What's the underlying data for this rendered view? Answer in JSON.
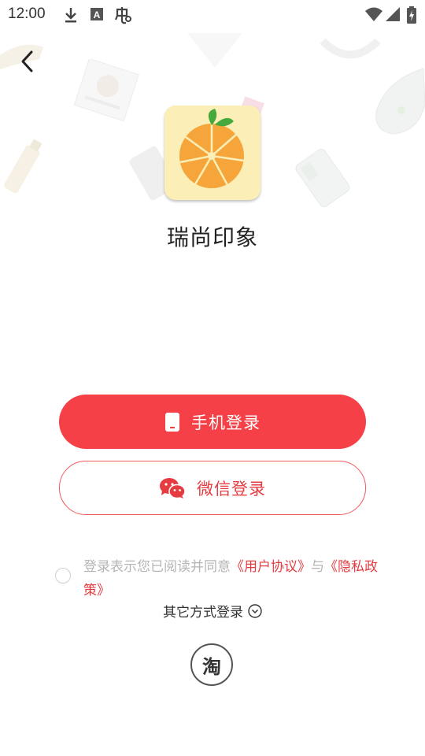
{
  "status_bar": {
    "time": "12:00",
    "icons": [
      "download-icon",
      "font-a-icon",
      "notification-app-icon",
      "wifi-icon",
      "signal-icon",
      "battery-charging-icon"
    ]
  },
  "header": {
    "back_icon": "chevron-left-icon"
  },
  "app": {
    "name": "瑞尚印象",
    "logo_icon": "orange-slice-logo"
  },
  "buttons": {
    "phone_login": "手机登录",
    "wechat_login": "微信登录"
  },
  "agreement": {
    "prefix": "登录表示您已阅读并同意",
    "user_agreement": "《用户协议》",
    "conjunction": "与",
    "privacy_policy": "《隐私政策》"
  },
  "other_login": {
    "label": "其它方式登录",
    "taobao_label": "淘"
  },
  "colors": {
    "accent": "#f44046",
    "link": "#e53c42",
    "logo_bg": "#fbeeb6",
    "orange": "#f5a53a"
  }
}
